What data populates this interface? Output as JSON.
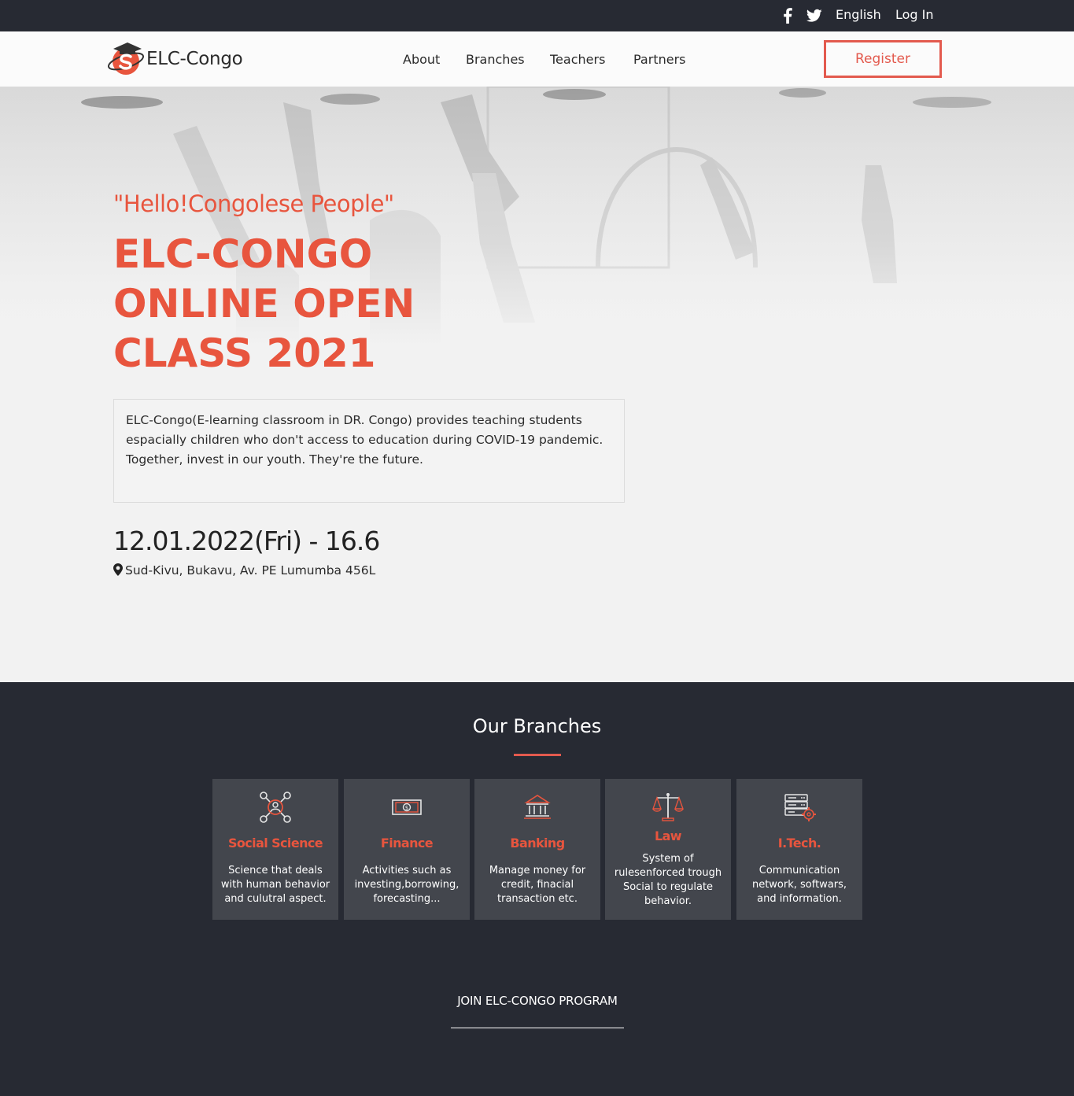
{
  "topbar": {
    "social": [
      "facebook-icon",
      "twitter-icon"
    ],
    "language": "English",
    "login": "Log In"
  },
  "navbar": {
    "logo_text": "ELC-Congo",
    "links": [
      "About",
      "Branches",
      "Teachers",
      "Partners"
    ],
    "register": "Register"
  },
  "hero": {
    "tagline": "\"Hello!Congolese People\"",
    "title_lines": [
      "ELC-CONGO",
      "ONLINE OPEN",
      "CLASS 2021"
    ],
    "description": [
      "ELC-Congo(E-learning classroom in DR. Congo) provides teaching students espacially children who don't access to education during COVID-19 pandemic.",
      "Together, invest in our youth. They're the future."
    ],
    "date": "12.01.2022(Fri) - 16.6",
    "location": "Sud-Kivu, Bukavu, Av. PE Lumumba 456L"
  },
  "branches": {
    "title": "Our Branches",
    "cards": [
      {
        "name": "Social Science",
        "text": "Science that deals with human behavior and culutral aspect.",
        "icon": "network-person-icon"
      },
      {
        "name": "Finance",
        "text": "Activities such as investing,borrowing, forecasting...",
        "icon": "banknote-icon"
      },
      {
        "name": "Banking",
        "text": "Manage money for credit, finacial transaction etc.",
        "icon": "bank-building-icon"
      },
      {
        "name": "Law",
        "text": "System of rulesenforced trough Social to regulate behavior.",
        "icon": "scales-icon"
      },
      {
        "name": "I.Tech.",
        "text": "Communication network, softwars, and information.",
        "icon": "server-gear-icon"
      }
    ],
    "join": "JOIN ELC-CONGO PROGRAM"
  },
  "colors": {
    "accent": "#e8553e",
    "dark": "#272a33",
    "card": "#43464d"
  }
}
